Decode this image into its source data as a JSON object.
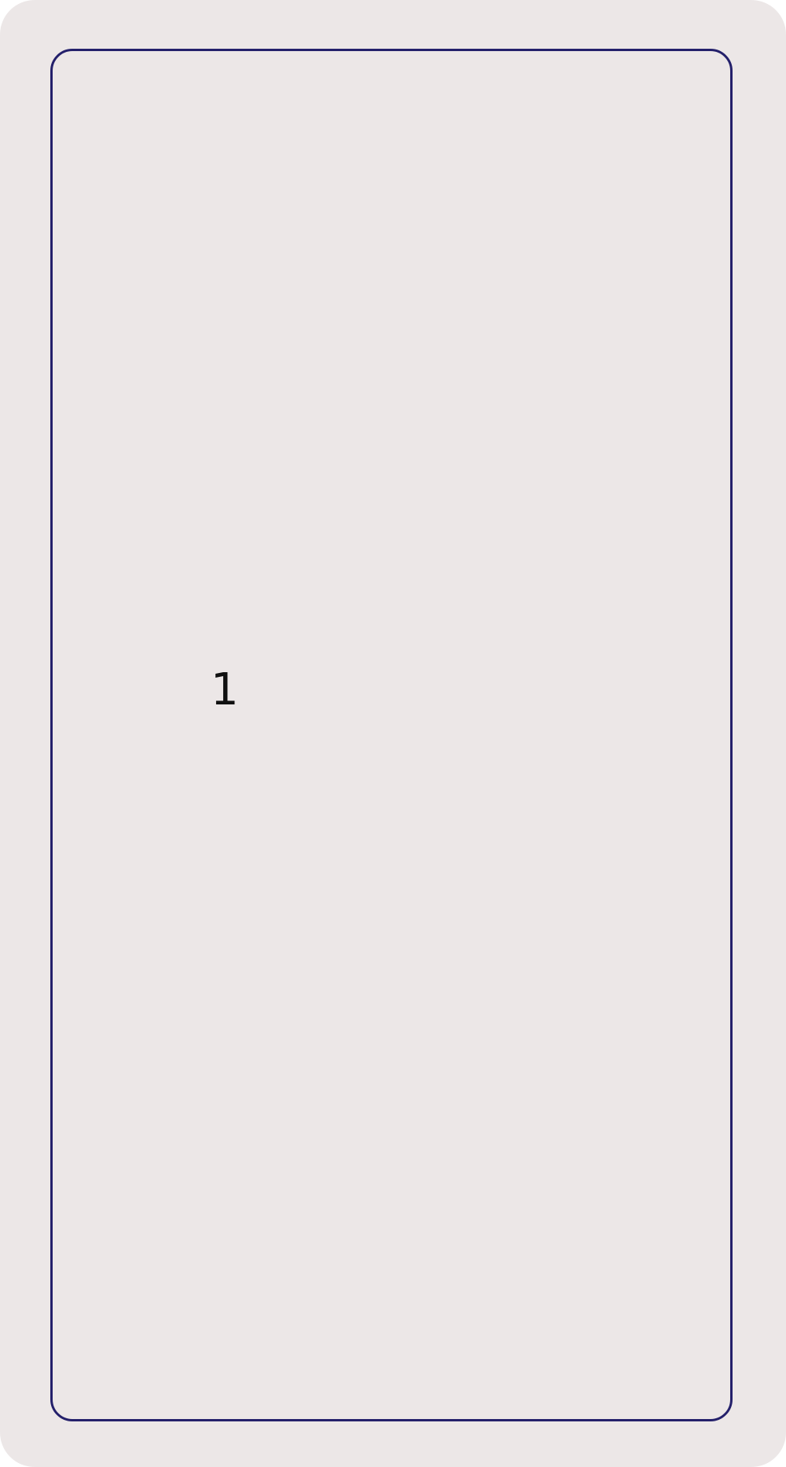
{
  "card": {
    "number": "1",
    "background_color": "#ece7e7",
    "frame_color": "#24206b",
    "text_color": "#111111"
  }
}
